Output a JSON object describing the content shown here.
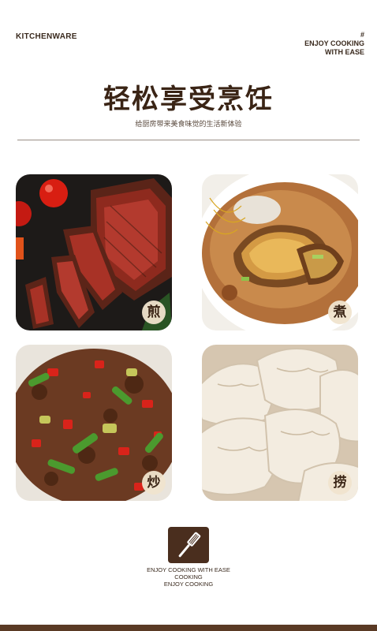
{
  "header": {
    "brand": "KITCHENWARE",
    "hash": "#",
    "slogan_line1": "ENJOY COOKING",
    "slogan_line2": "WITH EASE"
  },
  "main": {
    "title": "轻松享受烹饪",
    "subtitle": "给厨房带来美食味觉的生活新体验"
  },
  "cards": [
    {
      "label": "煎",
      "icon": "steak-photo"
    },
    {
      "label": "煮",
      "icon": "abalone-soup-photo"
    },
    {
      "label": "炒",
      "icon": "stir-fry-photo"
    },
    {
      "label": "捞",
      "icon": "dumplings-photo"
    }
  ],
  "footer": {
    "icon": "spatula-icon",
    "line1": "ENJOY COOKING WITH EASE",
    "line2": "COOKING",
    "line3": "ENJOY COOKING"
  },
  "colors": {
    "brown_dark": "#3a2415",
    "icon_bg": "#4a2e1e",
    "badge_bg": "#f0e4cd"
  }
}
